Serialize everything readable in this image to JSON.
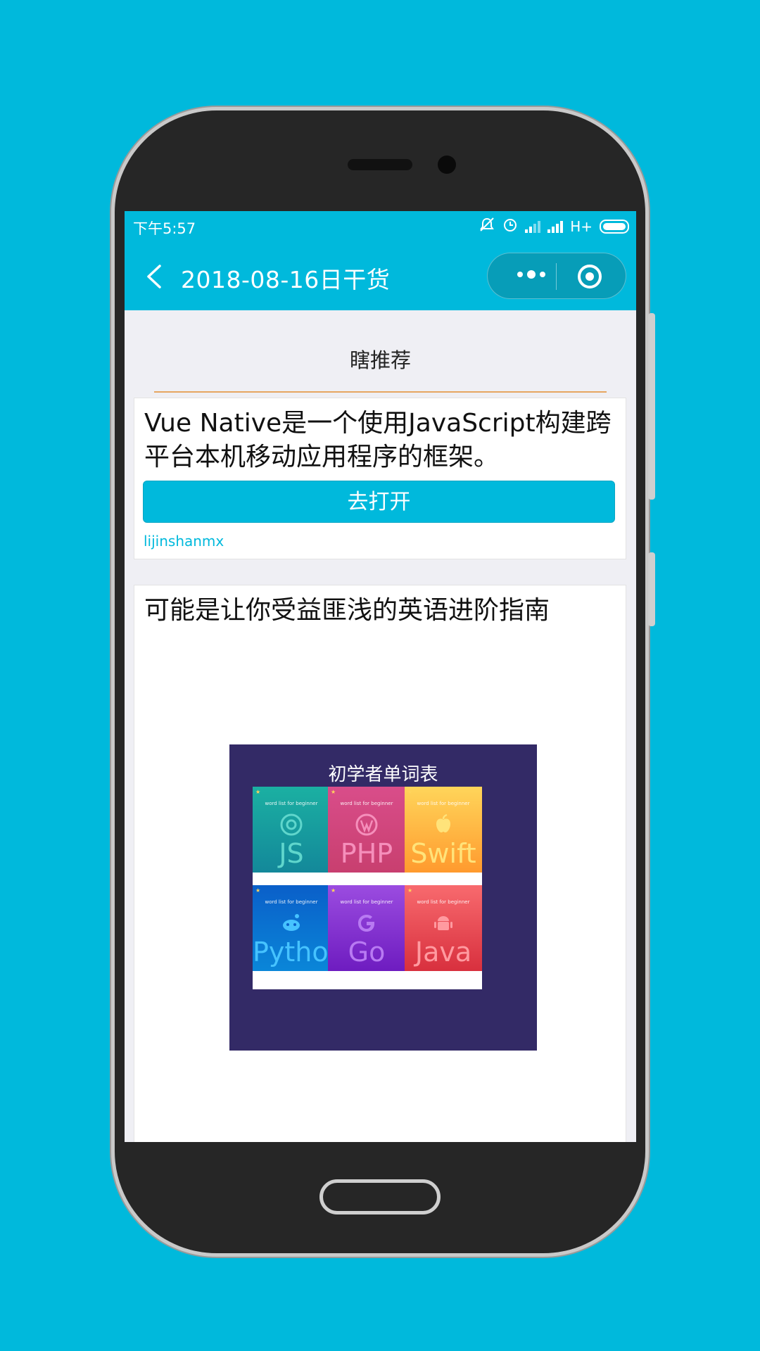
{
  "status": {
    "time": "下午5:57",
    "network": "H+"
  },
  "navbar": {
    "title": "2018-08-16日干货"
  },
  "section": {
    "title": "瞎推荐"
  },
  "article1": {
    "title": "Vue Native是一个使用JavaScript构建跨平台本机移动应用程序的框架。",
    "open_label": "去打开",
    "author": "lijinshanmx"
  },
  "article2": {
    "title": "可能是让你受益匪浅的英语进阶指南",
    "poster_title": "初学者单词表",
    "books": [
      {
        "name": "JS",
        "icon": "chrome-icon",
        "subtitle": "word list for beginner",
        "color_top": "#1bb0a2",
        "color_bottom": "#13889a",
        "text_color": "#5fd6cc"
      },
      {
        "name": "PHP",
        "icon": "wordpress-icon",
        "subtitle": "word list for beginner",
        "color_top": "#d94d8a",
        "color_bottom": "#c83f6f",
        "text_color": "#f58fbb"
      },
      {
        "name": "Swift",
        "icon": "apple-icon",
        "subtitle": "word list for beginner",
        "color_top": "#ffd55a",
        "color_bottom": "#ff9a2e",
        "text_color": "#ffe37a"
      },
      {
        "name": "Python",
        "icon": "reddit-icon",
        "subtitle": "word list for beginner",
        "color_top": "#0a5fc9",
        "color_bottom": "#0a86d8",
        "text_color": "#46c3ff"
      },
      {
        "name": "Go",
        "icon": "google-icon",
        "subtitle": "word list for beginner",
        "color_top": "#9b4ce0",
        "color_bottom": "#6e1cc0",
        "text_color": "#b87af2"
      },
      {
        "name": "Java",
        "icon": "android-icon",
        "subtitle": "word list for beginner",
        "color_top": "#f86a6e",
        "color_bottom": "#d8303e",
        "text_color": "#ff9aa0"
      }
    ]
  },
  "colors": {
    "accent": "#00b9dc",
    "section_line": "#e6a661"
  },
  "carousel": {
    "count": 2,
    "active": 2
  }
}
